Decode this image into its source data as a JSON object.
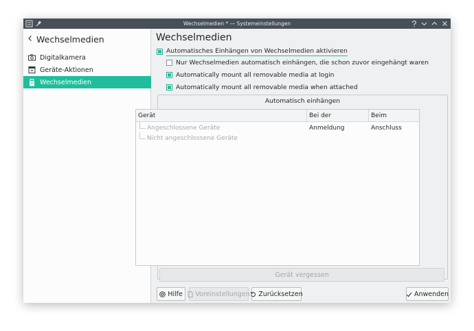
{
  "window": {
    "title": "Wechselmedien * — Systemeinstellungen"
  },
  "sidebar": {
    "back_icon": "chevron-left-icon",
    "heading": "Wechselmedien",
    "items": [
      {
        "label": "Digitalkamera",
        "icon": "camera-icon"
      },
      {
        "label": "Geräte-Aktionen",
        "icon": "device-actions-icon"
      },
      {
        "label": "Wechselmedien",
        "icon": "removable-media-icon",
        "active": true
      }
    ]
  },
  "main": {
    "title": "Wechselmedien",
    "options": [
      {
        "label": "Automatisches Einhängen von Wechselmedien aktivieren",
        "checked": true
      },
      {
        "label": "Nur Wechselmedien automatisch einhängen, die schon zuvor eingehängt waren",
        "checked": false
      },
      {
        "label": "Automatically mount all removable media at login",
        "checked": true
      },
      {
        "label": "Automatically mount all removable media when attached",
        "checked": true
      }
    ],
    "group_title": "Automatisch einhängen",
    "tree": {
      "columns": [
        "Gerät",
        "Bei der Anmeldung",
        "Beim Anschluss"
      ],
      "rows": [
        "Angeschlossene Geräte",
        "Nicht angeschlossene Geräte"
      ]
    },
    "forget_button": "Gerät vergessen"
  },
  "footer": {
    "help": "Hilfe",
    "defaults": "Voreinstellungen",
    "reset": "Zurücksetzen",
    "apply": "Anwenden"
  },
  "colors": {
    "accent": "#20bd9c",
    "titlebar": "#475057",
    "window_bg": "#eff0f1"
  }
}
